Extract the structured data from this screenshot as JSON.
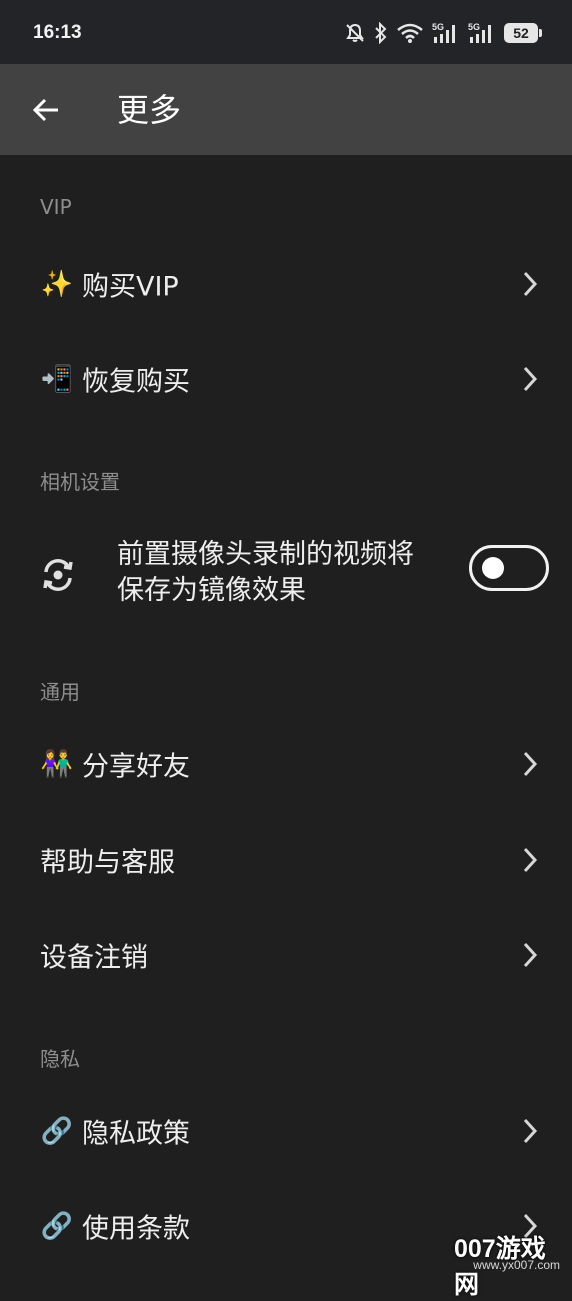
{
  "status_bar": {
    "time": "16:13",
    "battery": "52",
    "icons": [
      "bell-muted-icon",
      "bluetooth-icon",
      "wifi-icon",
      "signal-5g-icon",
      "signal-5g-icon",
      "battery-icon"
    ]
  },
  "toolbar": {
    "title": "更多",
    "back_icon": "arrow-left-icon"
  },
  "sections": {
    "vip": {
      "title": "VIP",
      "items": [
        {
          "emoji": "✨",
          "label": "购买VIP"
        },
        {
          "emoji": "📲",
          "label": "恢复购买"
        }
      ]
    },
    "camera": {
      "title": "相机设置",
      "mirror_label": "前置摄像头录制的视频将保存为镜像效果",
      "mirror_enabled": false
    },
    "general": {
      "title": "通用",
      "items": [
        {
          "emoji": "👫",
          "label": "分享好友"
        },
        {
          "emoji": "",
          "label": "帮助与客服"
        },
        {
          "emoji": "",
          "label": "设备注销"
        }
      ]
    },
    "privacy": {
      "title": "隐私",
      "items": [
        {
          "emoji": "🔗",
          "label": "隐私政策"
        },
        {
          "emoji": "🔗",
          "label": "使用条款"
        }
      ]
    }
  },
  "watermark": {
    "main": "007游戏网",
    "url": "www.yx007.com"
  },
  "colors": {
    "background": "#1f1f1f",
    "toolbar": "#424242",
    "status_bar": "#222428",
    "section_title": "#8e8e8e",
    "text": "#eeeeee"
  }
}
